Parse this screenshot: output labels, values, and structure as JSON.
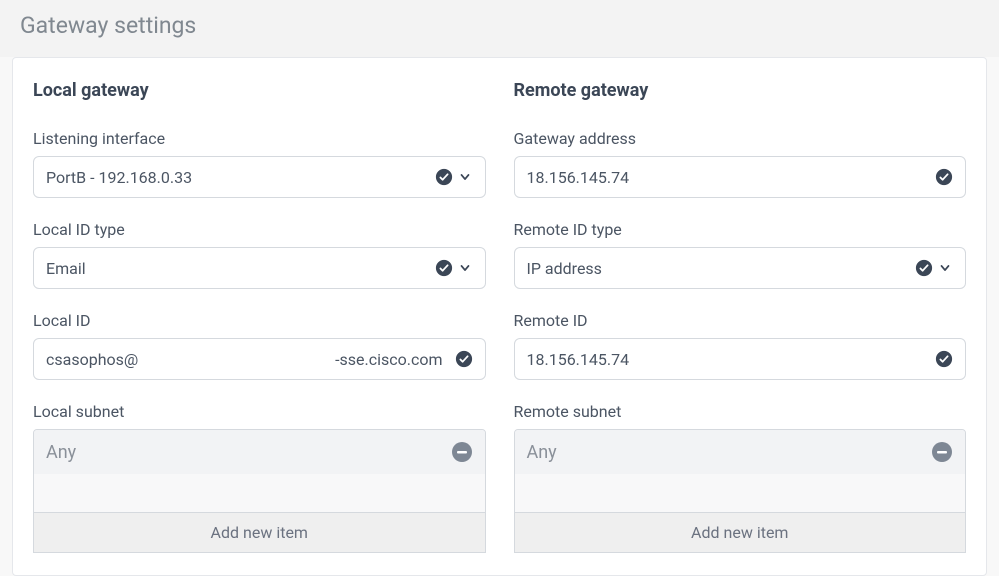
{
  "header": {
    "title": "Gateway settings"
  },
  "local": {
    "heading": "Local gateway",
    "listening_interface": {
      "label": "Listening interface",
      "value": "PortB - 192.168.0.33"
    },
    "id_type": {
      "label": "Local ID type",
      "value": "Email"
    },
    "id": {
      "label": "Local ID",
      "value_left": "csasophos@",
      "value_right": "-sse.cisco.com"
    },
    "subnet": {
      "label": "Local subnet",
      "items": [
        "Any"
      ],
      "add_label": "Add new item"
    }
  },
  "remote": {
    "heading": "Remote gateway",
    "address": {
      "label": "Gateway address",
      "value": "18.156.145.74"
    },
    "id_type": {
      "label": "Remote ID type",
      "value": "IP address"
    },
    "id": {
      "label": "Remote ID",
      "value": "18.156.145.74"
    },
    "subnet": {
      "label": "Remote subnet",
      "items": [
        "Any"
      ],
      "add_label": "Add new item"
    }
  }
}
